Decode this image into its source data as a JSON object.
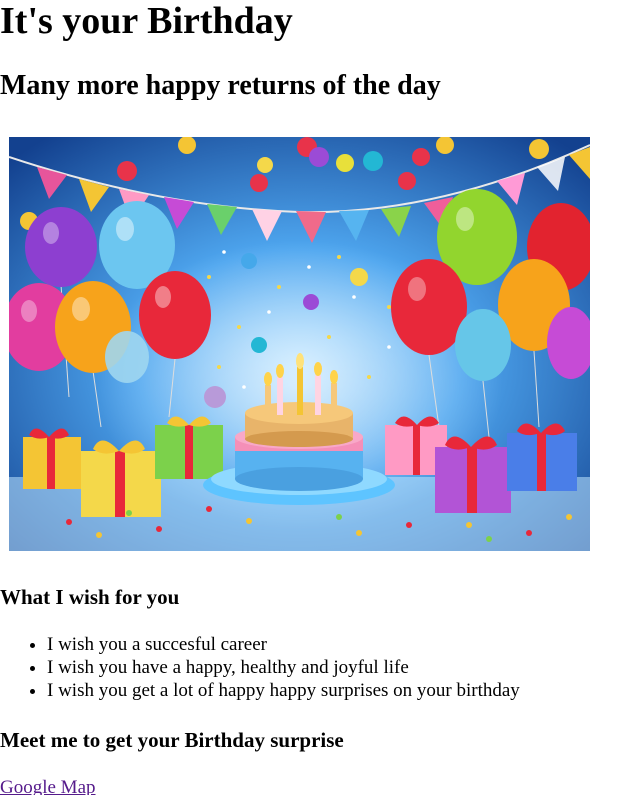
{
  "title": "It's your Birthday",
  "subtitle": "Many more happy returns of the day",
  "hero_image": {
    "colors": {
      "background": "#2f86e0",
      "cake": "#f6c87a",
      "frosting": "#f58fb8",
      "plate": "#5ec4ff"
    }
  },
  "wishes": {
    "heading": "What I wish for you",
    "items": [
      "I wish you a succesful career",
      "I wish you have a happy, healthy and joyful life",
      "I wish you get a lot of happy happy surprises on your birthday"
    ]
  },
  "meet": {
    "heading": "Meet me to get your Birthday surprise",
    "link_text": "Google Map"
  },
  "colors": {
    "link_visited": "#551a8b",
    "text": "#000000"
  }
}
